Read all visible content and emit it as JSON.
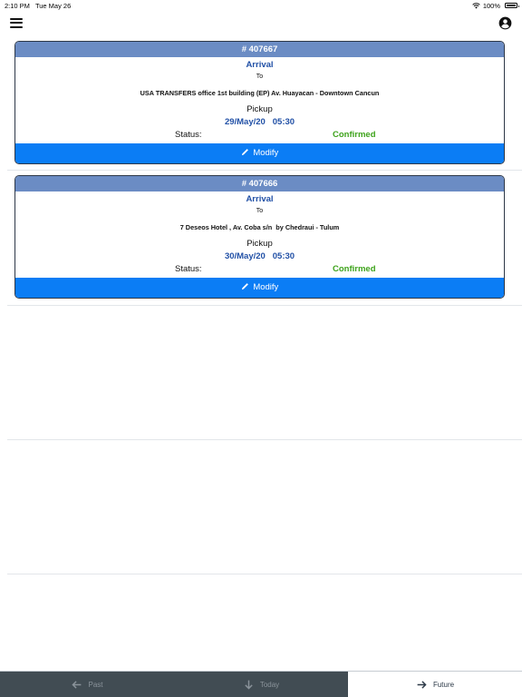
{
  "status_bar": {
    "time": "2:10 PM",
    "date": "Tue May 26",
    "battery": "100%"
  },
  "header": {
    "menu_icon": "hamburger-menu-icon",
    "account_icon": "account-circle-icon"
  },
  "bookings": [
    {
      "number": "# 407667",
      "type": "Arrival",
      "to_label": "To",
      "destination": "USA TRANSFERS office 1st building (EP) Av. Huayacan - Downtown Cancun",
      "pickup_label": "Pickup",
      "datetime": "29/May/20   05:30",
      "status_label": "Status:",
      "status_value": "Confirmed",
      "modify_label": "Modify"
    },
    {
      "number": "# 407666",
      "type": "Arrival",
      "to_label": "To",
      "destination": "7 Deseos Hotel , Av. Coba s/n  by Chedraui - Tulum",
      "pickup_label": "Pickup",
      "datetime": "30/May/20   05:30",
      "status_label": "Status:",
      "status_value": "Confirmed",
      "modify_label": "Modify"
    }
  ],
  "bottom_nav": {
    "past": "Past",
    "today": "Today",
    "future": "Future",
    "active": "future"
  },
  "colors": {
    "card_header": "#6b8cc4",
    "accent_text": "#2150a6",
    "confirmed": "#3ea31b",
    "modify_button": "#0b7df5",
    "nav_inactive": "#414c53"
  }
}
